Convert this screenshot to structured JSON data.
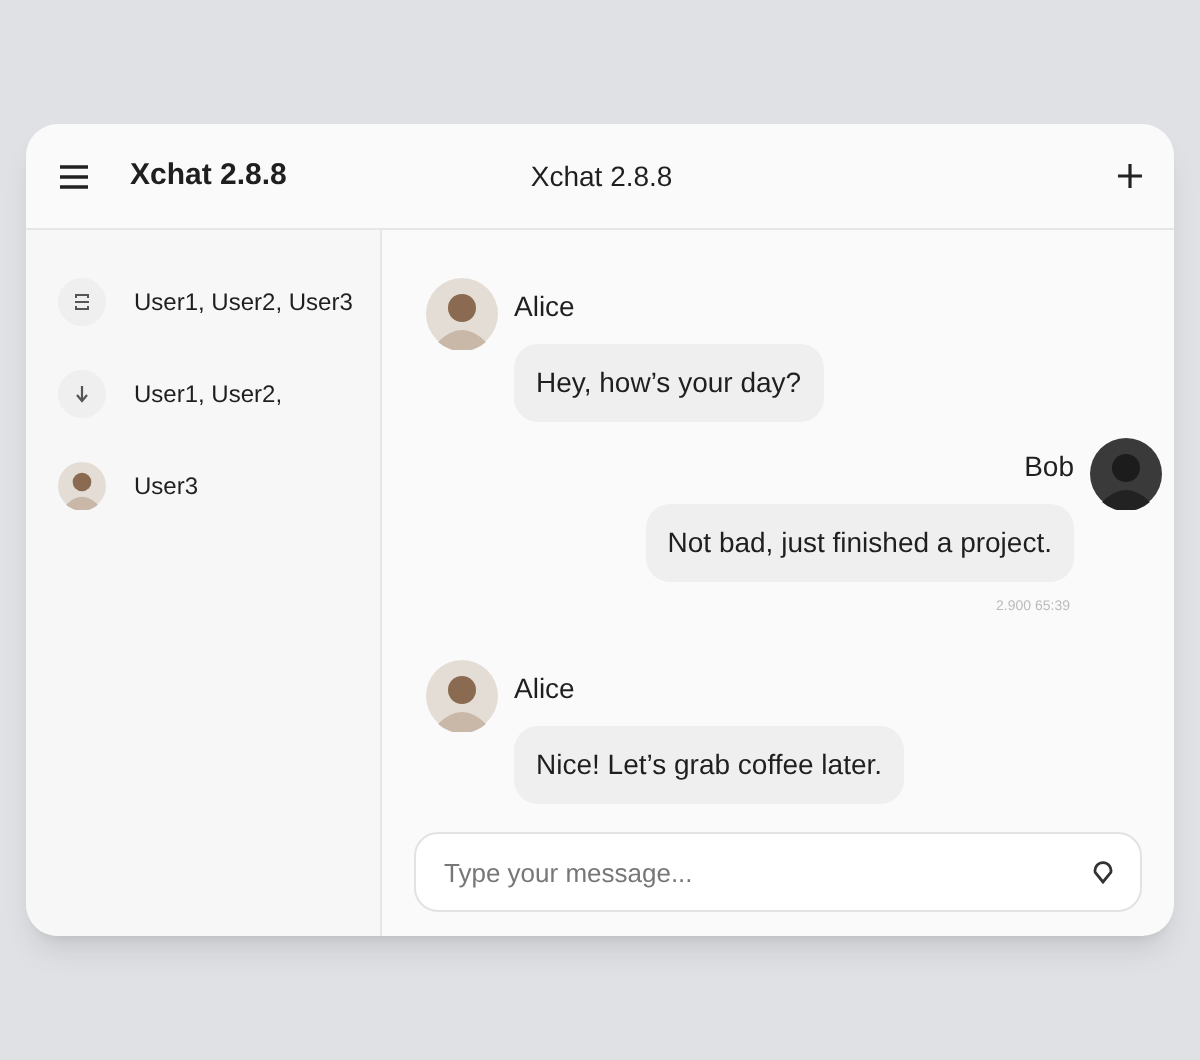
{
  "header": {
    "app_title": "Xchat 2.8.8",
    "chat_title": "Xchat 2.8.8"
  },
  "sidebar": {
    "items": [
      {
        "kind": "group",
        "label": "User1, User2, User3"
      },
      {
        "kind": "arrow",
        "label": "User1, User2,"
      },
      {
        "kind": "avatar",
        "label": "User3"
      }
    ]
  },
  "messages": [
    {
      "kind": "incoming",
      "sender": "Alice",
      "text": "Hey, how’s your day?"
    },
    {
      "kind": "outgoing",
      "sender": "Bob",
      "text": "Not bad, just finished a project.",
      "time": "2.900 65:39"
    },
    {
      "kind": "incoming",
      "sender": "Alice",
      "text": "Nice! Let’s grab coffee later."
    }
  ],
  "composer": {
    "placeholder": "Type your message..."
  }
}
